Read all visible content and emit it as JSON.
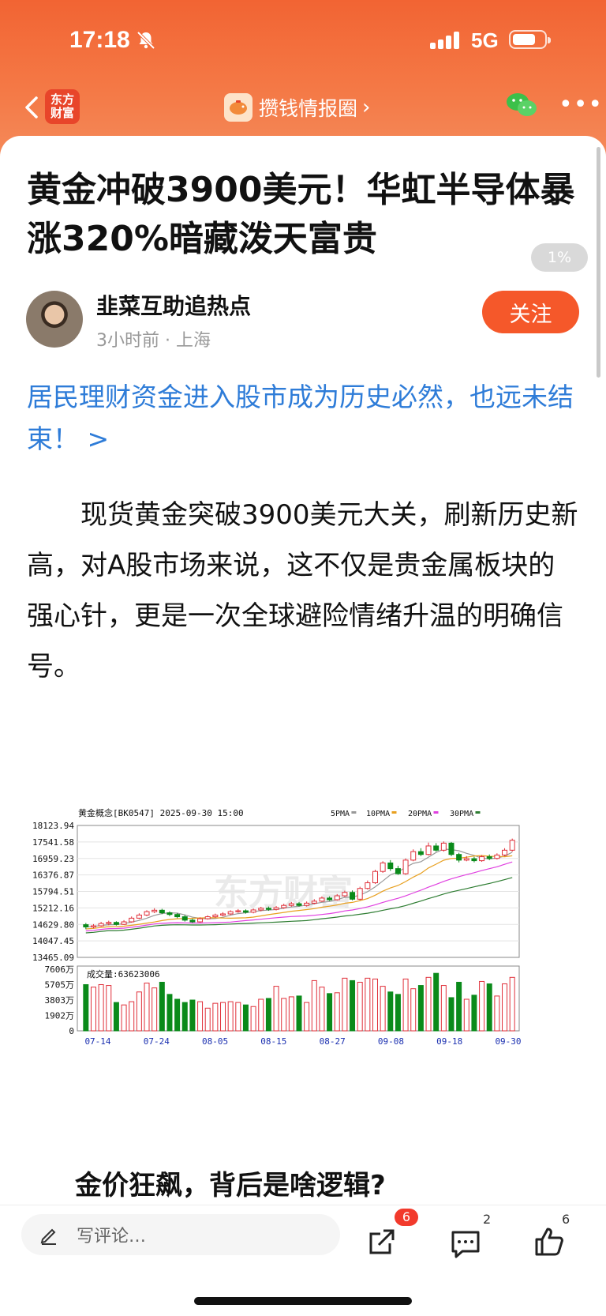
{
  "status": {
    "time": "17:18",
    "network": "5G"
  },
  "nav": {
    "logo_line1": "东方",
    "logo_line2": "财富",
    "channel": "攒钱情报圈"
  },
  "article": {
    "title": "黄金冲破3900美元！华虹半导体暴涨320%暗藏泼天富贵",
    "read_progress": "1%",
    "author": "韭菜互助追热点",
    "meta": "3小时前 · 上海",
    "follow_label": "关注",
    "promo": "居民理财资金进入股市成为历史必然，也远未结束！ >",
    "paragraph": "现货黄金突破3900美元大关，刷新历史新高，对A股市场来说，这不仅是贵金属板块的强心针，更是一次全球避险情绪升温的明确信号。",
    "subheading": "金价狂飙，背后是啥逻辑?"
  },
  "chart_data": {
    "type": "candlestick",
    "header": "黄金概念[BK0547] 2025-09-30 15:00",
    "legend": [
      {
        "name": "5PMA",
        "color": "#999999"
      },
      {
        "name": "10PMA",
        "color": "#e8a020"
      },
      {
        "name": "20PMA",
        "color": "#e040e0"
      },
      {
        "name": "30PMA",
        "color": "#2e7d32"
      }
    ],
    "price_ticks": [
      "18123.94",
      "17541.58",
      "16959.23",
      "16376.87",
      "15794.51",
      "15212.16",
      "14629.80",
      "14047.45",
      "13465.09"
    ],
    "ylim": [
      13465.09,
      18123.94
    ],
    "volume_label": "成交量:63623006",
    "volume_ticks": [
      "7606万",
      "5705万",
      "3803万",
      "1902万",
      "0"
    ],
    "volume_max": 7606,
    "date_labels": [
      "07-14",
      "07-24",
      "08-05",
      "08-15",
      "08-27",
      "09-08",
      "09-18",
      "09-30"
    ],
    "watermark": "东方财富",
    "up_color": "#e0303a",
    "down_color": "#0a8a1a",
    "candles": [
      [
        14620,
        14540,
        14680,
        14460
      ],
      [
        14540,
        14580,
        14640,
        14490
      ],
      [
        14580,
        14660,
        14720,
        14550
      ],
      [
        14660,
        14700,
        14760,
        14600
      ],
      [
        14700,
        14630,
        14740,
        14590
      ],
      [
        14630,
        14720,
        14780,
        14610
      ],
      [
        14720,
        14850,
        14910,
        14690
      ],
      [
        14850,
        14960,
        15020,
        14820
      ],
      [
        14960,
        15080,
        15130,
        14920
      ],
      [
        15080,
        15130,
        15200,
        15030
      ],
      [
        15130,
        15040,
        15180,
        14990
      ],
      [
        15040,
        14980,
        15090,
        14920
      ],
      [
        14980,
        14900,
        15030,
        14850
      ],
      [
        14900,
        14780,
        14960,
        14730
      ],
      [
        14780,
        14720,
        14830,
        14680
      ],
      [
        14720,
        14830,
        14880,
        14690
      ],
      [
        14830,
        14900,
        14950,
        14800
      ],
      [
        14900,
        14960,
        15010,
        14860
      ],
      [
        14960,
        15000,
        15060,
        14920
      ],
      [
        15000,
        15080,
        15130,
        14960
      ],
      [
        15080,
        15110,
        15170,
        15040
      ],
      [
        15110,
        15060,
        15160,
        15010
      ],
      [
        15060,
        15140,
        15190,
        15020
      ],
      [
        15140,
        15200,
        15250,
        15090
      ],
      [
        15200,
        15160,
        15260,
        15110
      ],
      [
        15160,
        15220,
        15280,
        15120
      ],
      [
        15220,
        15300,
        15360,
        15180
      ],
      [
        15300,
        15360,
        15420,
        15260
      ],
      [
        15360,
        15300,
        15420,
        15260
      ],
      [
        15300,
        15380,
        15440,
        15260
      ],
      [
        15380,
        15450,
        15520,
        15340
      ],
      [
        15450,
        15560,
        15620,
        15420
      ],
      [
        15560,
        15500,
        15620,
        15460
      ],
      [
        15500,
        15640,
        15700,
        15470
      ],
      [
        15640,
        15760,
        15820,
        15600
      ],
      [
        15760,
        15520,
        15830,
        15480
      ],
      [
        15520,
        15900,
        15960,
        15480
      ],
      [
        15900,
        16100,
        16180,
        15860
      ],
      [
        16100,
        16500,
        16560,
        16060
      ],
      [
        16500,
        16800,
        16860,
        16450
      ],
      [
        16800,
        16600,
        16900,
        16520
      ],
      [
        16600,
        16420,
        16700,
        16380
      ],
      [
        16420,
        16900,
        16960,
        16380
      ],
      [
        16900,
        17200,
        17280,
        16860
      ],
      [
        17200,
        17100,
        17320,
        17040
      ],
      [
        17100,
        17400,
        17520,
        17060
      ],
      [
        17400,
        17250,
        17500,
        17200
      ],
      [
        17250,
        17500,
        17560,
        17200
      ],
      [
        17500,
        17100,
        17540,
        17040
      ],
      [
        17100,
        16900,
        17160,
        16820
      ],
      [
        16900,
        16950,
        17040,
        16860
      ],
      [
        16950,
        16880,
        17020,
        16820
      ],
      [
        16880,
        17020,
        17080,
        16840
      ],
      [
        17020,
        16960,
        17100,
        16900
      ],
      [
        16960,
        17080,
        17140,
        16920
      ],
      [
        17080,
        17250,
        17320,
        17040
      ],
      [
        17250,
        17600,
        17660,
        17200
      ]
    ],
    "volume": [
      5705,
      5400,
      5705,
      5600,
      3500,
      3200,
      3600,
      4800,
      5900,
      5300,
      6000,
      4500,
      3900,
      3500,
      3800,
      3600,
      2800,
      3400,
      3500,
      3600,
      3500,
      3200,
      3000,
      3900,
      4000,
      5500,
      4000,
      4200,
      4300,
      3500,
      6200,
      5400,
      4600,
      4700,
      6500,
      6200,
      6000,
      6500,
      6400,
      5500,
      4800,
      4500,
      6400,
      5200,
      5600,
      6600,
      7100,
      5600,
      4100,
      6000,
      3900,
      4400,
      6100,
      5800,
      4300,
      5800,
      6600
    ]
  }
}
